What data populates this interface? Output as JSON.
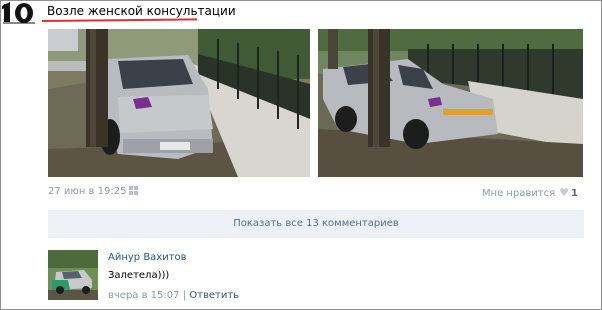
{
  "post": {
    "title": "Возле женской консультации",
    "date": "27 июн в 19:25",
    "likes_label": "Мне нравится",
    "likes_count": "1"
  },
  "comments": {
    "show_all_label": "Показать все 13 комментариев",
    "items": [
      {
        "author": "Айнур Вахитов",
        "text": "Залетела)))",
        "timestamp": "вчера в 15:07",
        "separator": "|",
        "reply_label": "Ответить"
      }
    ]
  },
  "icons": [
    "number-10-logo-icon",
    "windows-icon",
    "heart-icon"
  ],
  "colors": {
    "title_underline": "#e03030",
    "link": "#2b587a",
    "muted": "#8e9aab",
    "button_bg": "#edf1f5"
  }
}
